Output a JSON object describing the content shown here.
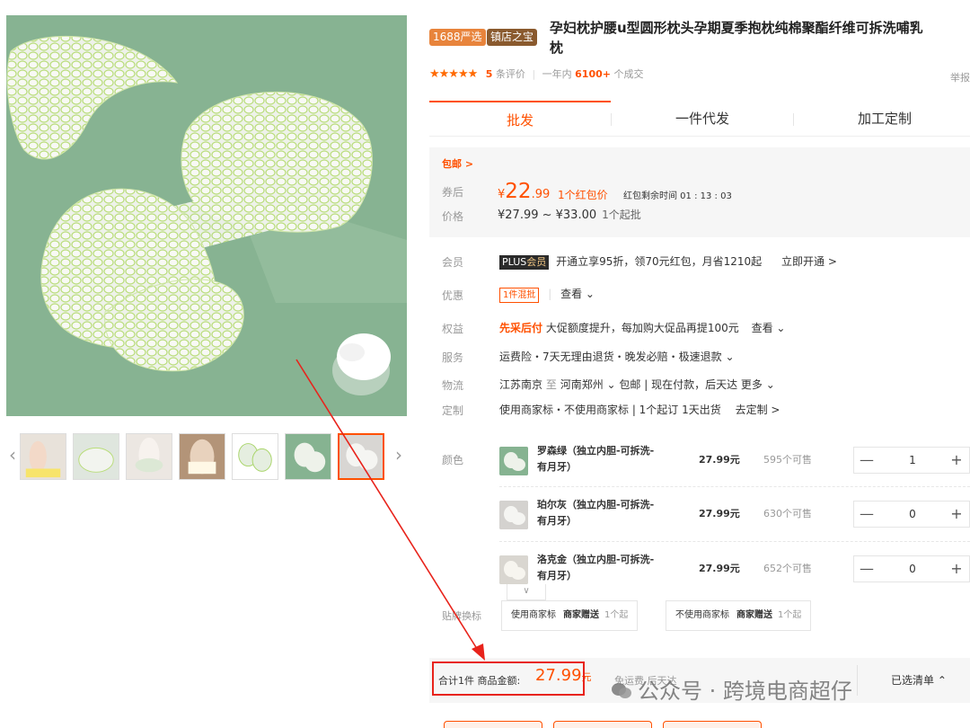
{
  "gallery": {
    "thumbnails": [
      "thumb-1",
      "thumb-2",
      "thumb-3",
      "thumb-4",
      "thumb-5",
      "thumb-6",
      "thumb-7"
    ],
    "active_index": 6,
    "prev_icon": "‹",
    "next_icon": "›"
  },
  "product": {
    "badge_1688": "1688严选",
    "badge_shop": "镇店之宝",
    "title_line1": "孕妇枕护腰u型圆形枕头孕期夏季抱枕纯棉聚酯纤维可拆洗哺乳",
    "title_line2": "枕",
    "stars": "★★★★★",
    "review_count": "5",
    "review_suffix": "条评价",
    "sales_prefix": "一年内",
    "sales_count": "6100+",
    "sales_suffix": "个成交",
    "report": "举报"
  },
  "tabs": [
    "批发",
    "一件代发",
    "加工定制"
  ],
  "price": {
    "baoyou": "包邮 >",
    "coupon_label_1": "券后",
    "coupon_label_2": "价格",
    "yen": "¥",
    "price_int": "22",
    "price_dec": ".99",
    "hongbao": "1个红包价",
    "countdown": "红包剩余时间 01 : 13 : 03",
    "range": "¥27.99 ~ ¥33.00",
    "min_qty": "1个起批"
  },
  "info_rows": {
    "member_label": "会员",
    "plus_tag_1": "PLUS",
    "plus_tag_2": "会员",
    "member_text": "开通立享95折，领70元红包，月省1210起",
    "member_link": "立即开通 >",
    "promo_label": "优惠",
    "promo_tag": "1件混批",
    "promo_link": "查看 ⌄",
    "rights_label": "权益",
    "rights_red": "先采后付",
    "rights_text": "大促额度提升，每加购大促品再提100元",
    "rights_link": "查看 ⌄",
    "service_label": "服务",
    "service_text": "运费险・7天无理由退货・晚发必赔・极速退款 ⌄",
    "logistics_label": "物流",
    "logistics_from": "江苏南京",
    "logistics_to_word": "至",
    "logistics_to": "河南郑州 ⌄",
    "logistics_text": "包邮 | 现在付款，后天达",
    "logistics_more": "更多 ⌄",
    "custom_label": "定制",
    "custom_text": "使用商家标・不使用商家标  |  1个起订  1天出货",
    "custom_link": "去定制 >"
  },
  "skus": {
    "label": "颜色",
    "items": [
      {
        "name": "罗森绿（独立内胆-可拆洗-有月牙）",
        "price": "27.99元",
        "stock": "595个可售",
        "qty": "1"
      },
      {
        "name": "珀尔灰（独立内胆-可拆洗-有月牙）",
        "price": "27.99元",
        "stock": "630个可售",
        "qty": "0"
      },
      {
        "name": "洛克金（独立内胆-可拆洗-有月牙）",
        "price": "27.99元",
        "stock": "652个可售",
        "qty": "0"
      }
    ],
    "minus": "—",
    "plus": "+",
    "more_icon": "∨"
  },
  "label_opts": {
    "label": "贴牌换标",
    "opt1_a": "使用商家标",
    "opt1_b": "商家赠送",
    "opt1_c": "1个起",
    "opt2_a": "不使用商家标",
    "opt2_b": "商家赠送",
    "opt2_c": "1个起"
  },
  "bottom": {
    "total": "合计1件    商品金额:",
    "amount": "27.99",
    "unit": "元",
    "free": "免运费  后天达",
    "selected": "已选清单 ⌃"
  },
  "watermark": "公众号 · 跨境电商超仔",
  "colors": {
    "accent": "#ff5000",
    "highlight": "#e8231b"
  }
}
